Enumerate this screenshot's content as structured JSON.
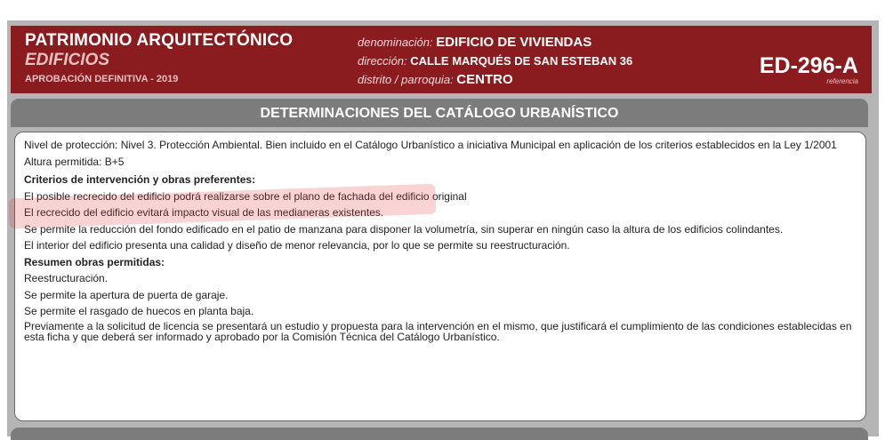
{
  "header": {
    "title": "PATRIMONIO ARQUITECTÓNICO",
    "subtitle": "EDIFICIOS",
    "approval": "APROBACIÓN DEFINITIVA - 2019",
    "denominacion_label": "denominación",
    "denominacion_value": "EDIFICIO DE VIVIENDAS",
    "direccion_label": "dirección",
    "direccion_value": "CALLE MARQUÉS DE SAN ESTEBAN  36",
    "distrito_label": "distrito / parroquia",
    "distrito_value": "CENTRO",
    "code": "ED-296-A",
    "code_label": "referencia"
  },
  "section": {
    "title": "DETERMINACIONES DEL CATÁLOGO URBANÍSTICO"
  },
  "content": {
    "proteccion": "Nivel de protección: Nivel 3. Protección Ambiental. Bien incluido en el Catálogo Urbanístico a iniciativa Municipal en aplicación de los criterios establecidos en la Ley 1/2001",
    "altura": "Altura permitida: B+5",
    "criterios_heading": "Criterios de intervención y obras preferentes:",
    "criterios": [
      "El posible recrecido del edificio podrá realizarse sobre el plano de fachada del edificio original",
      "El recrecido del edificio evitará impacto visual de las medianeras existentes.",
      "Se permite la reducción del fondo edificado en el patio de manzana para disponer la volumetría, sin superar en ningún caso la altura de los edificios colindantes.",
      "El interior del edificio presenta una calidad y diseño de menor relevancia, por lo que se permite su reestructuración."
    ],
    "resumen_heading": "Resumen obras permitidas:",
    "resumen": [
      "Reestructuración.",
      "Se permite la apertura de puerta de garaje.",
      "Se permite el rasgado de huecos en planta baja."
    ],
    "nota": "Previamente a la solicitud de licencia se presentará un estudio y propuesta para la intervención en el mismo, que justificará el cumplimiento de las condiciones establecidas en esta ficha y que deberá ser informado y aprobado por la Comisión Técnica del Catálogo Urbanístico."
  }
}
